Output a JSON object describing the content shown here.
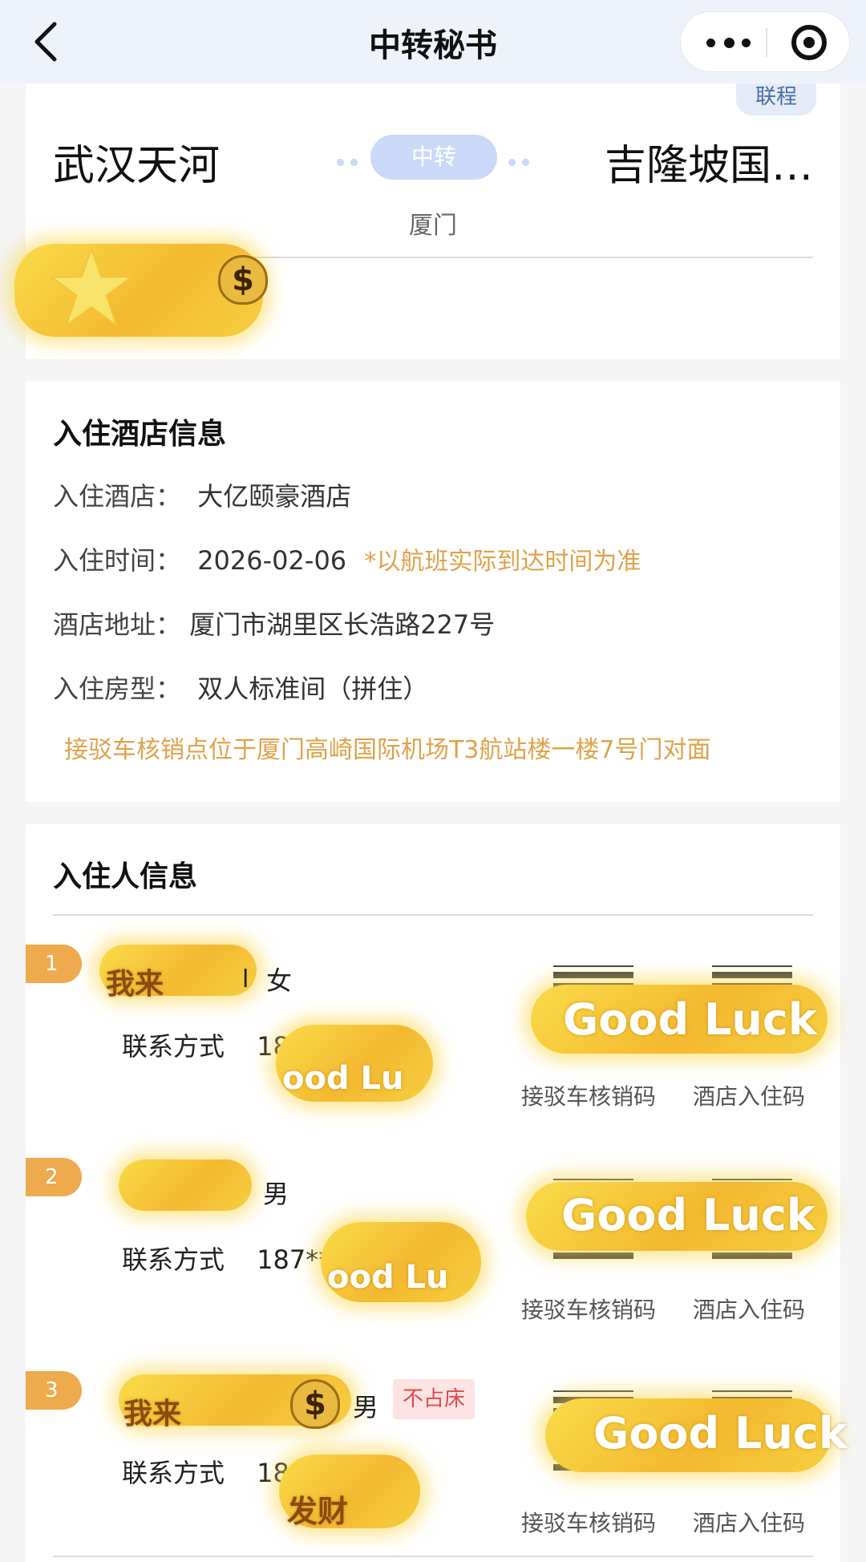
{
  "navbar": {
    "title": "中转秘书",
    "back_icon": "chevron-left-icon",
    "more_icon": "more-dots-icon",
    "close_icon": "target-icon"
  },
  "route": {
    "tag": "联程",
    "from": "武汉天河",
    "to": "吉隆坡国…",
    "transit_label": "中转",
    "transit_city": "厦门"
  },
  "hotel": {
    "section_title": "入住酒店信息",
    "hotel_label": "入住酒店：",
    "hotel_value": "大亿颐豪酒店",
    "time_label": "入住时间：",
    "time_value": "2026-02-06",
    "time_note": "*以航班实际到达时间为准",
    "address_label": "酒店地址：",
    "address_value": "厦门市湖里区长浩路227号",
    "room_label": "入住房型：",
    "room_value": "双人标准间（拼住）",
    "pickup_note": "接驳车核销点位于厦门高崎国际机场T3航站楼一楼7号门对面"
  },
  "guests": {
    "section_title": "入住人信息",
    "contact_label": "联系方式",
    "pickup_code_label": "接驳车核销码",
    "hotel_code_label": "酒店入住码",
    "items": [
      {
        "num": "1",
        "name_visible": "l",
        "gender": "女",
        "phone_visible": "18",
        "no_bed": ""
      },
      {
        "num": "2",
        "name_visible": "",
        "gender": "男",
        "phone_visible": "187**",
        "no_bed": ""
      },
      {
        "num": "3",
        "name_visible": "",
        "gender": "男",
        "phone_visible": "18",
        "no_bed": "不占床"
      }
    ]
  },
  "stickers": {
    "luck_text": "Good Luck",
    "luck_text_short": "ood Lu",
    "coin_symbol": "$",
    "lai_text": "我来",
    "cai_text": "发财"
  },
  "colors": {
    "accent_orange": "#eeaa4d",
    "note_orange": "#e0a24a",
    "transit_blue": "#c9d9f7",
    "no_bed_red": "#e04b4b"
  }
}
